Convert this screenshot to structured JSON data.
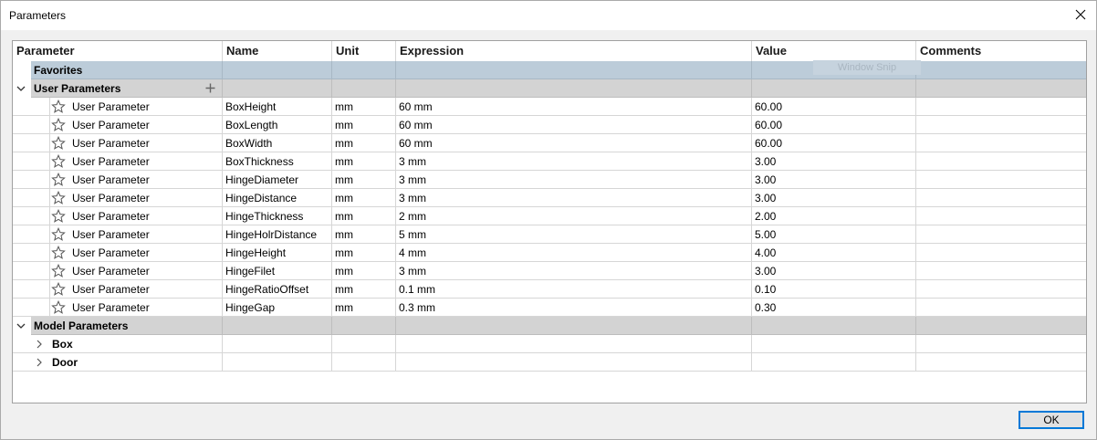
{
  "window": {
    "title": "Parameters"
  },
  "columns": {
    "parameter": "Parameter",
    "name": "Name",
    "unit": "Unit",
    "expression": "Expression",
    "value": "Value",
    "comments": "Comments"
  },
  "favorites": {
    "label": "Favorites",
    "overlay": "Window Snip"
  },
  "user_parameters": {
    "label": "User Parameters",
    "add_icon": "plus-icon",
    "rows": [
      {
        "type": "User Parameter",
        "name": "BoxHeight",
        "unit": "mm",
        "expression": "60 mm",
        "value": "60.00",
        "comments": ""
      },
      {
        "type": "User Parameter",
        "name": "BoxLength",
        "unit": "mm",
        "expression": "60 mm",
        "value": "60.00",
        "comments": ""
      },
      {
        "type": "User Parameter",
        "name": "BoxWidth",
        "unit": "mm",
        "expression": "60 mm",
        "value": "60.00",
        "comments": ""
      },
      {
        "type": "User Parameter",
        "name": "BoxThickness",
        "unit": "mm",
        "expression": "3 mm",
        "value": "3.00",
        "comments": ""
      },
      {
        "type": "User Parameter",
        "name": "HingeDiameter",
        "unit": "mm",
        "expression": "3 mm",
        "value": "3.00",
        "comments": ""
      },
      {
        "type": "User Parameter",
        "name": "HingeDistance",
        "unit": "mm",
        "expression": "3 mm",
        "value": "3.00",
        "comments": ""
      },
      {
        "type": "User Parameter",
        "name": "HingeThickness",
        "unit": "mm",
        "expression": "2 mm",
        "value": "2.00",
        "comments": ""
      },
      {
        "type": "User Parameter",
        "name": "HingeHolrDistance",
        "unit": "mm",
        "expression": "5 mm",
        "value": "5.00",
        "comments": ""
      },
      {
        "type": "User Parameter",
        "name": "HingeHeight",
        "unit": "mm",
        "expression": "4 mm",
        "value": "4.00",
        "comments": ""
      },
      {
        "type": "User Parameter",
        "name": "HingeFilet",
        "unit": "mm",
        "expression": "3 mm",
        "value": "3.00",
        "comments": ""
      },
      {
        "type": "User Parameter",
        "name": "HingeRatioOffset",
        "unit": "mm",
        "expression": "0.1 mm",
        "value": "0.10",
        "comments": ""
      },
      {
        "type": "User Parameter",
        "name": "HingeGap",
        "unit": "mm",
        "expression": "0.3 mm",
        "value": "0.30",
        "comments": ""
      }
    ]
  },
  "model_parameters": {
    "label": "Model Parameters",
    "children": [
      {
        "label": "Box"
      },
      {
        "label": "Door"
      }
    ]
  },
  "footer": {
    "ok_label": "OK"
  },
  "colors": {
    "favorites_bg": "#bcccd9",
    "group_bg": "#d3d3d3",
    "accent": "#0078d7"
  }
}
